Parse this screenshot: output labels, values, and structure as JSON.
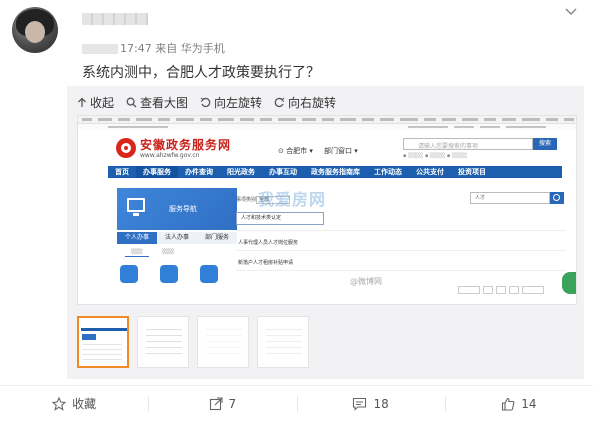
{
  "post": {
    "time": "17:47",
    "source": "来自 华为手机",
    "text": "系统内测中，合肥人才政策要执行了？"
  },
  "media_toolbar": {
    "collapse": "收起",
    "view_large": "查看大图",
    "rotate_left": "向左旋转",
    "rotate_right": "向右旋转"
  },
  "screenshot": {
    "site_title": "安徽政务服务网",
    "site_url": "www.ahzwfw.gov.cn",
    "city": "合肥市",
    "dept": "部门窗口",
    "search_placeholder": "请输入您要搜索的事项",
    "search_button": "搜索",
    "nav": [
      "首页",
      "办事服务",
      "办件查询",
      "阳光政务",
      "办事互动",
      "政务服务指南库",
      "工作动态",
      "公共支付",
      "投资项目"
    ],
    "panel_title": "服务导航",
    "panel_tabs": [
      "个人办事",
      "法人办事",
      "部门服务"
    ],
    "filter_label": "事项类别",
    "filter_value": "全部",
    "mini_search_value": "人才",
    "suggest_item": "人才和技术类认定",
    "list_items": [
      "人事代理人员人才岗位服务",
      "新落户人才租房补贴申请"
    ],
    "watermark_site": "我爱房网",
    "watermark_weibo": "@微博网"
  },
  "footer": {
    "favorite_label": "收藏",
    "repost_count": "7",
    "comment_count": "18",
    "like_count": "14"
  }
}
